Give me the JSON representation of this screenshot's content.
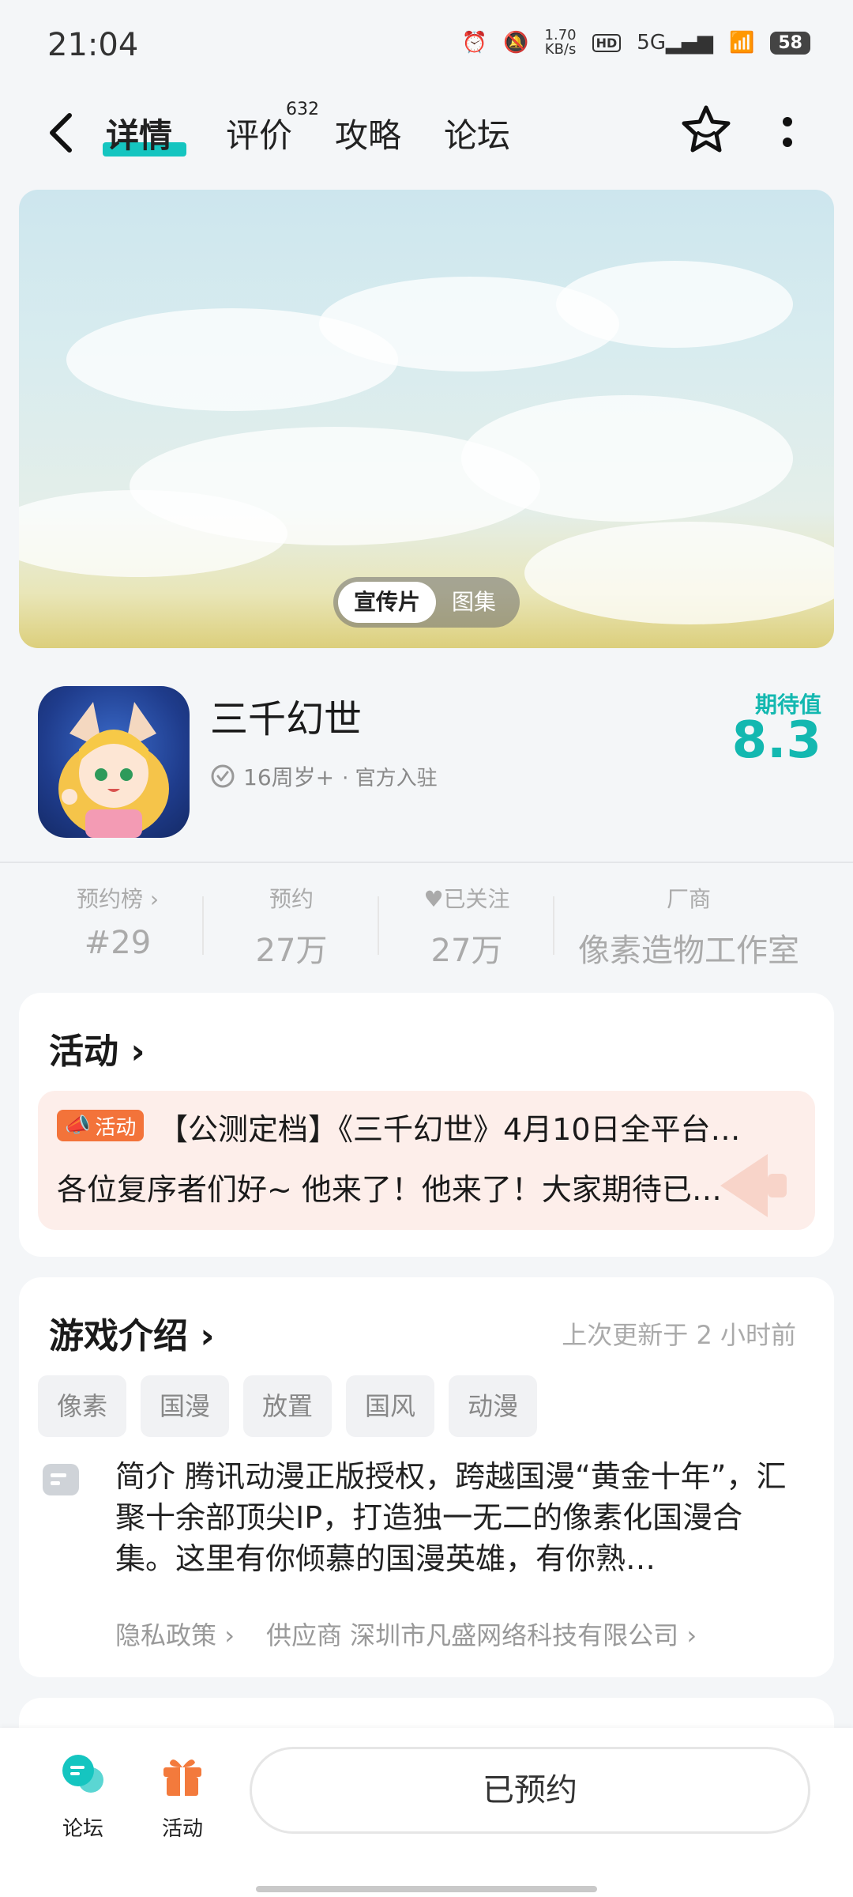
{
  "status_bar": {
    "time": "21:04",
    "net_speed_value": "1.70",
    "net_speed_unit": "KB/s",
    "hd": "HD",
    "signal": "5G",
    "battery": "58"
  },
  "nav": {
    "tabs": [
      {
        "label": "详情"
      },
      {
        "label": "评价"
      },
      {
        "label": "攻略"
      },
      {
        "label": "论坛"
      }
    ],
    "review_count": "632"
  },
  "banner": {
    "toggle": {
      "video": "宣传片",
      "gallery": "图集"
    }
  },
  "app": {
    "name": "三千幻世",
    "age_rating": "16周岁+",
    "official": "· 官方入驻",
    "expect_label": "期待值",
    "expect_value": "8.3"
  },
  "stats": [
    {
      "label": "预约榜",
      "value": "#29"
    },
    {
      "label": "预约",
      "value": "27万"
    },
    {
      "label": "已关注",
      "value": "27万"
    },
    {
      "label": "厂商",
      "value": "像素造物工作室"
    }
  ],
  "activity": {
    "title": "活动",
    "tag": "活动",
    "headline": "【公测定档】《三千幻世》4月10日全平台…",
    "body": "各位复序者们好~ 他来了！他来了！大家期待已…"
  },
  "intro": {
    "title": "游戏介绍",
    "updated": "上次更新于 2 小时前",
    "tags": [
      "像素",
      "国漫",
      "放置",
      "国风",
      "动漫"
    ],
    "label": "简介",
    "text": "腾讯动漫正版授权，跨越国漫“黄金十年”，汇聚十余部顶尖IP，打造独一无二的像素化国漫合集。这里有你倾慕的国漫英雄，有你熟…",
    "privacy": "隐私政策",
    "supplier": "供应商 深圳市凡盛网络科技有限公司"
  },
  "bottom_bar": {
    "forum": "论坛",
    "activity": "活动",
    "reserve": "已预约"
  },
  "colors": {
    "accent": "#13b8b0",
    "activity_orange": "#f3733a",
    "activity_bg": "#fdeeea"
  }
}
